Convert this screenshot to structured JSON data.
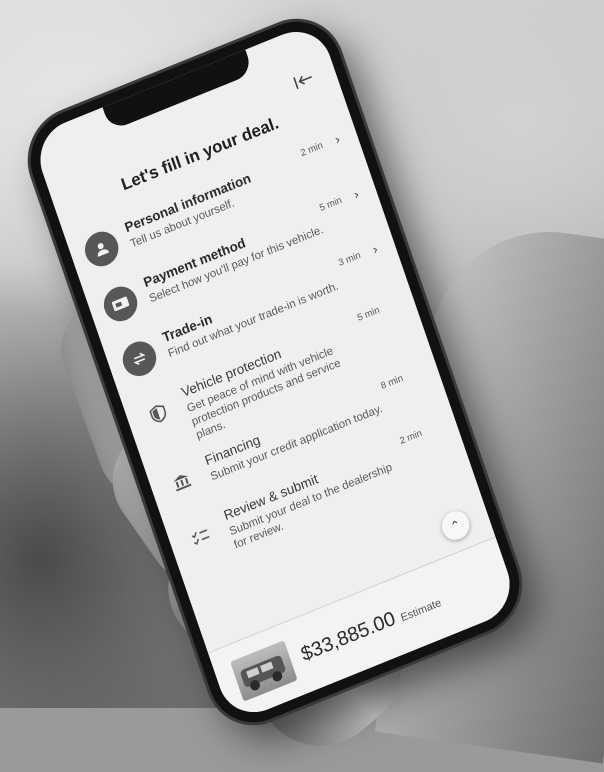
{
  "header": {
    "title": "Let's fill in your deal."
  },
  "steps": [
    {
      "title": "Personal information",
      "description": "Tell us about yourself.",
      "time": "2 min",
      "icon": "person-icon",
      "has_chevron": true
    },
    {
      "title": "Payment method",
      "description": "Select how you'll pay for this vehicle.",
      "time": "5 min",
      "icon": "payment-icon",
      "has_chevron": true
    },
    {
      "title": "Trade-in",
      "description": "Find out what your trade-in is worth.",
      "time": "3 min",
      "icon": "swap-icon",
      "has_chevron": true
    },
    {
      "title": "Vehicle protection",
      "description": "Get peace of mind with vehicle protection products and service plans.",
      "time": "5 min",
      "icon": "shield-icon",
      "has_chevron": false
    },
    {
      "title": "Financing",
      "description": "Submit your credit application today.",
      "time": "8 min",
      "icon": "bank-icon",
      "has_chevron": false
    },
    {
      "title": "Review & submit",
      "description": "Submit your deal to the dealership for review.",
      "time": "2 min",
      "icon": "checklist-icon",
      "has_chevron": false
    }
  ],
  "footer": {
    "price": "$33,885.00",
    "price_label": "Estimate"
  },
  "colors": {
    "screen_bg": "#efefef",
    "icon_fill": "#575757"
  }
}
